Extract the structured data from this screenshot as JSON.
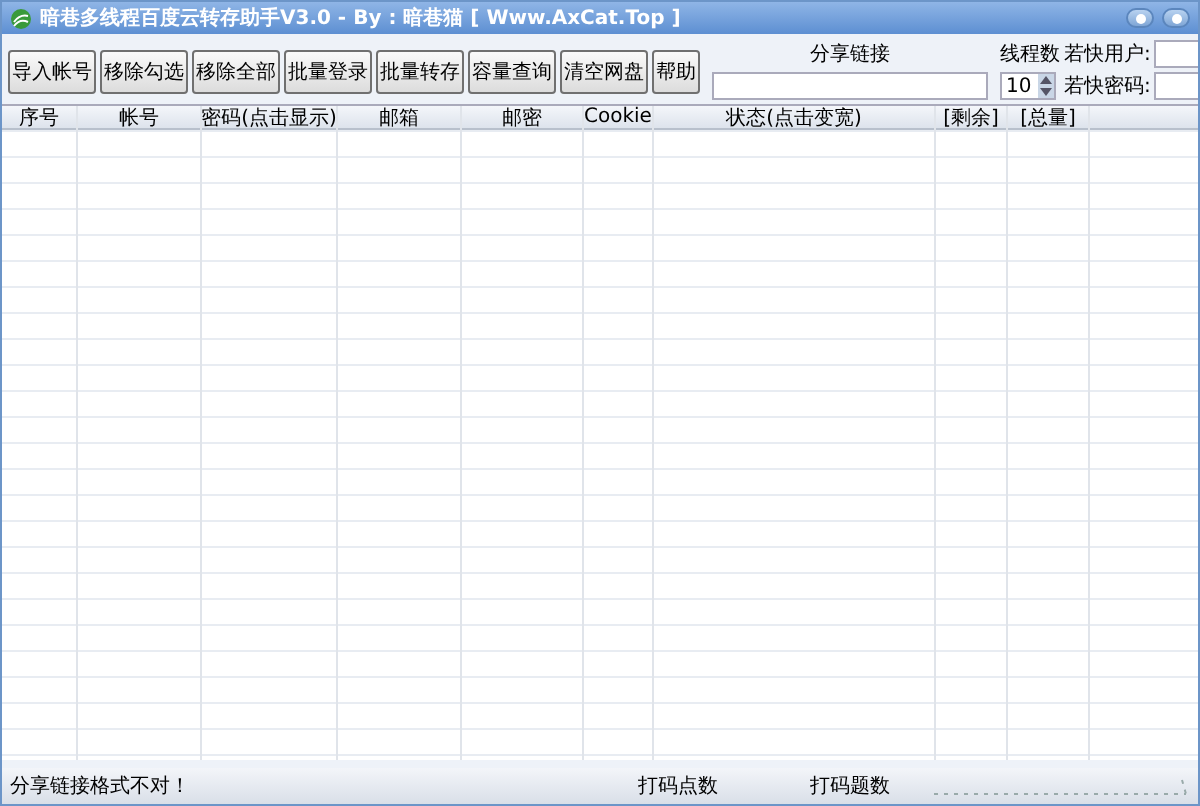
{
  "window": {
    "title": "暗巷多线程百度云转存助手V3.0 - By : 暗巷猫 [ Www.AxCat.Top ]"
  },
  "toolbar": [
    "导入帐号",
    "移除勾选",
    "移除全部",
    "批量登录",
    "批量转存",
    "容量查询",
    "清空网盘",
    "帮助"
  ],
  "share_link": {
    "label": "分享链接"
  },
  "threads": {
    "label": "线程数",
    "value": "10"
  },
  "ruokuai_user": {
    "label": "若快用户:"
  },
  "ruokuai_password": {
    "label": "若快密码:"
  },
  "table": {
    "columns": [
      "序号",
      "帐号",
      "密码(点击显示)",
      "邮箱",
      "邮密",
      "Cookie",
      "状态(点击变宽)",
      "[剩余]",
      "[总量]"
    ]
  },
  "status_bar": [
    "分享链接格式不对！",
    "打码点数",
    "打码题数"
  ]
}
